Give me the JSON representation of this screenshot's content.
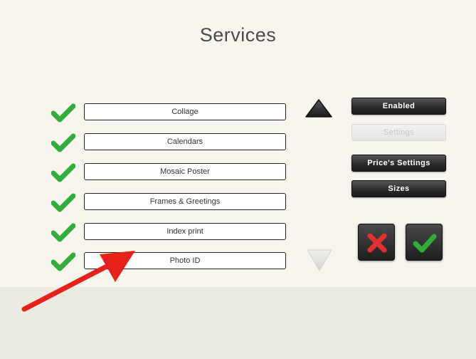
{
  "title": "Services",
  "services": [
    {
      "label": "Collage",
      "enabled": true
    },
    {
      "label": "Calendars",
      "enabled": true
    },
    {
      "label": "Mosaic Poster",
      "enabled": true
    },
    {
      "label": "Frames & Greetings",
      "enabled": true
    },
    {
      "label": "Index print",
      "enabled": true
    },
    {
      "label": "Photo ID",
      "enabled": true
    }
  ],
  "buttons": {
    "enabled": "Enabled",
    "settings": "Settings",
    "prices_settings": "Price's Settings",
    "sizes": "Sizes"
  },
  "icons": {
    "check": "check-icon",
    "scroll_up": "triangle-up-icon",
    "scroll_down": "triangle-down-icon",
    "cancel": "x-icon",
    "confirm": "check-icon",
    "annotation": "red-arrow"
  },
  "colors": {
    "check_green": "#2fae3c",
    "cancel_red": "#e03030",
    "arrow_red": "#e8201a",
    "button_dark": "#2b2b2b"
  }
}
